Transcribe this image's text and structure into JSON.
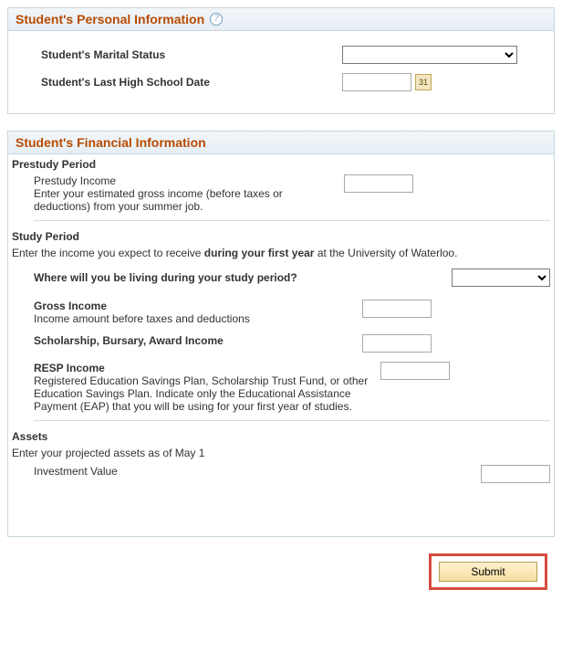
{
  "personal": {
    "heading": "Student's Personal Information",
    "help_glyph": "?",
    "marital_label": "Student's Marital Status",
    "marital_value": "",
    "hs_date_label": "Student's Last High School Date",
    "hs_date_value": "",
    "calendar_glyph": "31"
  },
  "financial": {
    "heading": "Student's Financial Information",
    "prestudy": {
      "heading": "Prestudy Period",
      "income_title": "Prestudy Income",
      "income_desc": "Enter your estimated gross income (before taxes or deductions) from your summer job."
    },
    "study": {
      "heading": "Study Period",
      "intro_a": "Enter the income you expect to receive ",
      "intro_bold": "during your first year",
      "intro_b": " at the University of Waterloo.",
      "living_label": "Where will you be living during your study period?",
      "gross_title": "Gross Income",
      "gross_desc": "Income amount before taxes and deductions",
      "sba_title": "Scholarship, Bursary, Award Income",
      "resp_title": "RESP Income",
      "resp_desc": "Registered Education Savings Plan, Scholarship Trust Fund, or other Education Savings Plan. Indicate only the Educational Assistance Payment (EAP) that you will be using for your first year of studies."
    },
    "assets": {
      "heading": "Assets",
      "intro": "Enter your projected assets as of May 1",
      "investment_title": "Investment Value"
    }
  },
  "actions": {
    "submit_label": "Submit"
  }
}
